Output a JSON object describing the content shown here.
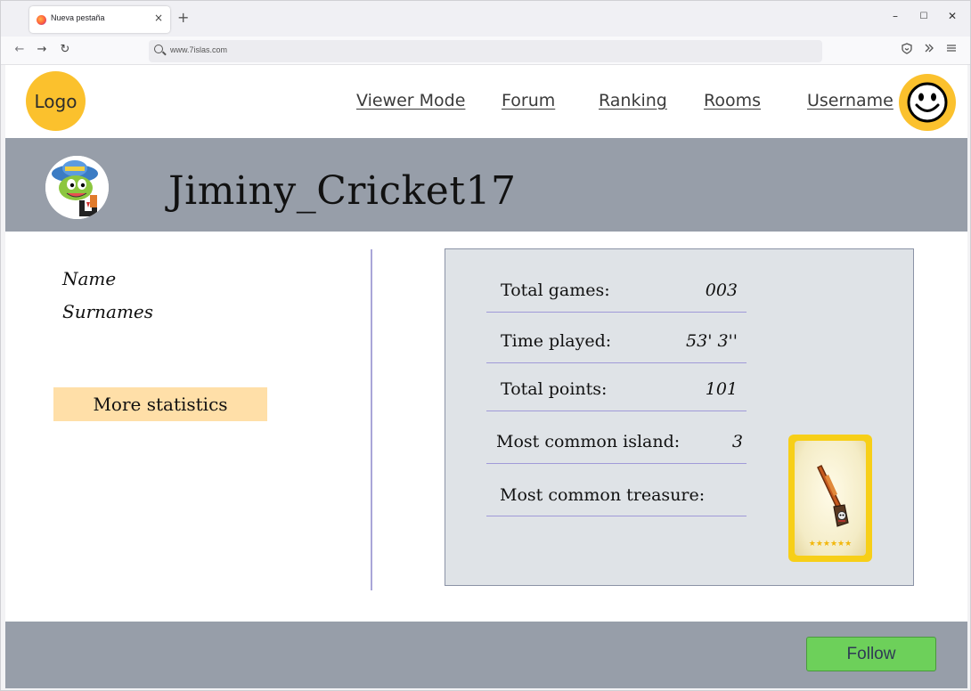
{
  "browser": {
    "tab_title": "Nueva pestaña",
    "tab_close": "×",
    "new_tab": "+",
    "url": "www.7islas.com",
    "window_controls": [
      "–",
      "☐",
      "✕"
    ],
    "nav_buttons": [
      "←",
      "→",
      "↻"
    ],
    "toolbar_icons": [
      "shield-icon",
      "chevrons-icon",
      "menu-icon"
    ]
  },
  "header": {
    "logo_text": "Logo",
    "nav": [
      "Viewer Mode",
      "Forum",
      "Ranking",
      "Rooms",
      "Username"
    ],
    "accent_color": "#fbc12d"
  },
  "profile": {
    "username": "Jiminy_Cricket17",
    "name_label": "Name",
    "surnames_label": "Surnames",
    "more_stats_label": "More statistics"
  },
  "stats": {
    "total_games_label": "Total games:",
    "total_games_value": "003",
    "time_played_label": "Time played:",
    "time_played_value": "53' 3''",
    "total_points_label": "Total points:",
    "total_points_value": "101",
    "common_island_label": "Most common island:",
    "common_island_value": "3",
    "common_treasure_label": "Most common treasure:"
  },
  "footer": {
    "follow_label": "Follow",
    "band_color": "#979ea9"
  }
}
